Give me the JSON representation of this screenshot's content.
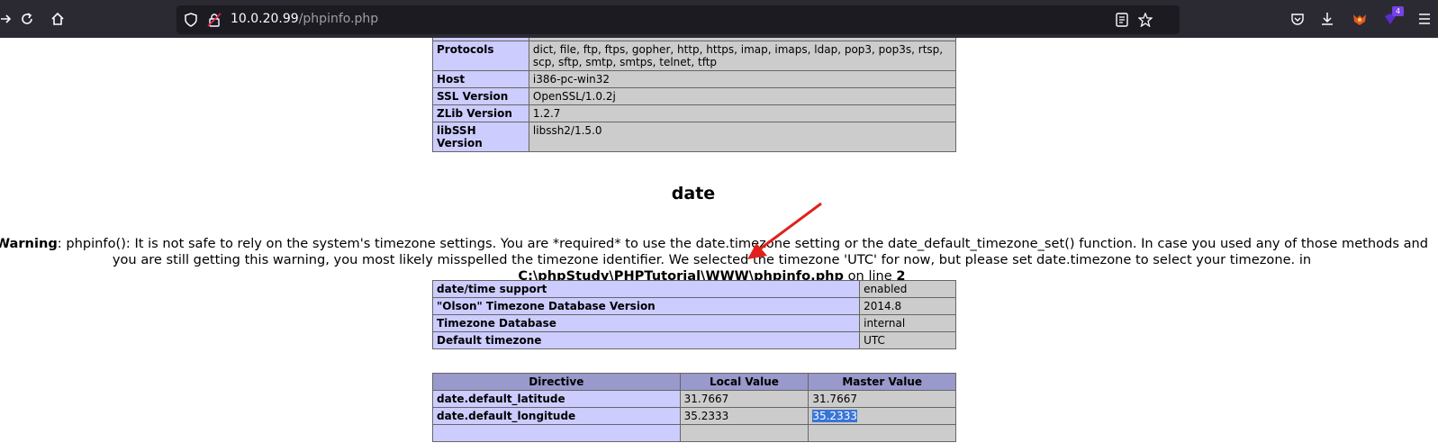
{
  "browser": {
    "url_host": "10.0.20.99",
    "url_path": "/phpinfo.php",
    "extension_badge": "4"
  },
  "top_table": [
    {
      "name": "Protocols",
      "value": "dict, file, ftp, ftps, gopher, http, https, imap, imaps, ldap, pop3, pop3s, rtsp, scp, sftp, smtp, smtps, telnet, tftp"
    },
    {
      "name": "Host",
      "value": "i386-pc-win32"
    },
    {
      "name": "SSL Version",
      "value": "OpenSSL/1.0.2j"
    },
    {
      "name": "ZLib Version",
      "value": "1.2.7"
    },
    {
      "name": "libSSH Version",
      "value": "libssh2/1.5.0"
    }
  ],
  "date_section": {
    "title": "date",
    "warning_label": "Warning",
    "warning_text": ": phpinfo(): It is not safe to rely on the system's timezone settings. You are *required* to use the date.timezone setting or the date_default_timezone_set() function. In case you used any of those methods and you are still getting this warning, you most likely misspelled the timezone identifier. We selected the timezone 'UTC' for now, but please set date.timezone to select your timezone. in ",
    "warning_file": "C:\\phpStudy\\PHPTutorial\\WWW\\phpinfo.php",
    "warning_online": " on line ",
    "warning_line": "2"
  },
  "info_table": [
    {
      "name": "date/time support",
      "value": "enabled"
    },
    {
      "name": "\"Olson\" Timezone Database Version",
      "value": "2014.8"
    },
    {
      "name": "Timezone Database",
      "value": "internal"
    },
    {
      "name": "Default timezone",
      "value": "UTC"
    }
  ],
  "directive_table": {
    "headers": [
      "Directive",
      "Local Value",
      "Master Value"
    ],
    "rows": [
      {
        "directive": "date.default_latitude",
        "local": "31.7667",
        "master": "31.7667"
      },
      {
        "directive": "date.default_longitude",
        "local": "35.2333",
        "master": "35.2333"
      }
    ]
  },
  "colors": {
    "toolbar_bg": "#2b2a33",
    "urlbar_bg": "#1c1b22",
    "php_e": "#ccccff",
    "php_v": "#cccccc",
    "php_h": "#9999cc",
    "annotation_arrow": "#e0211b"
  }
}
